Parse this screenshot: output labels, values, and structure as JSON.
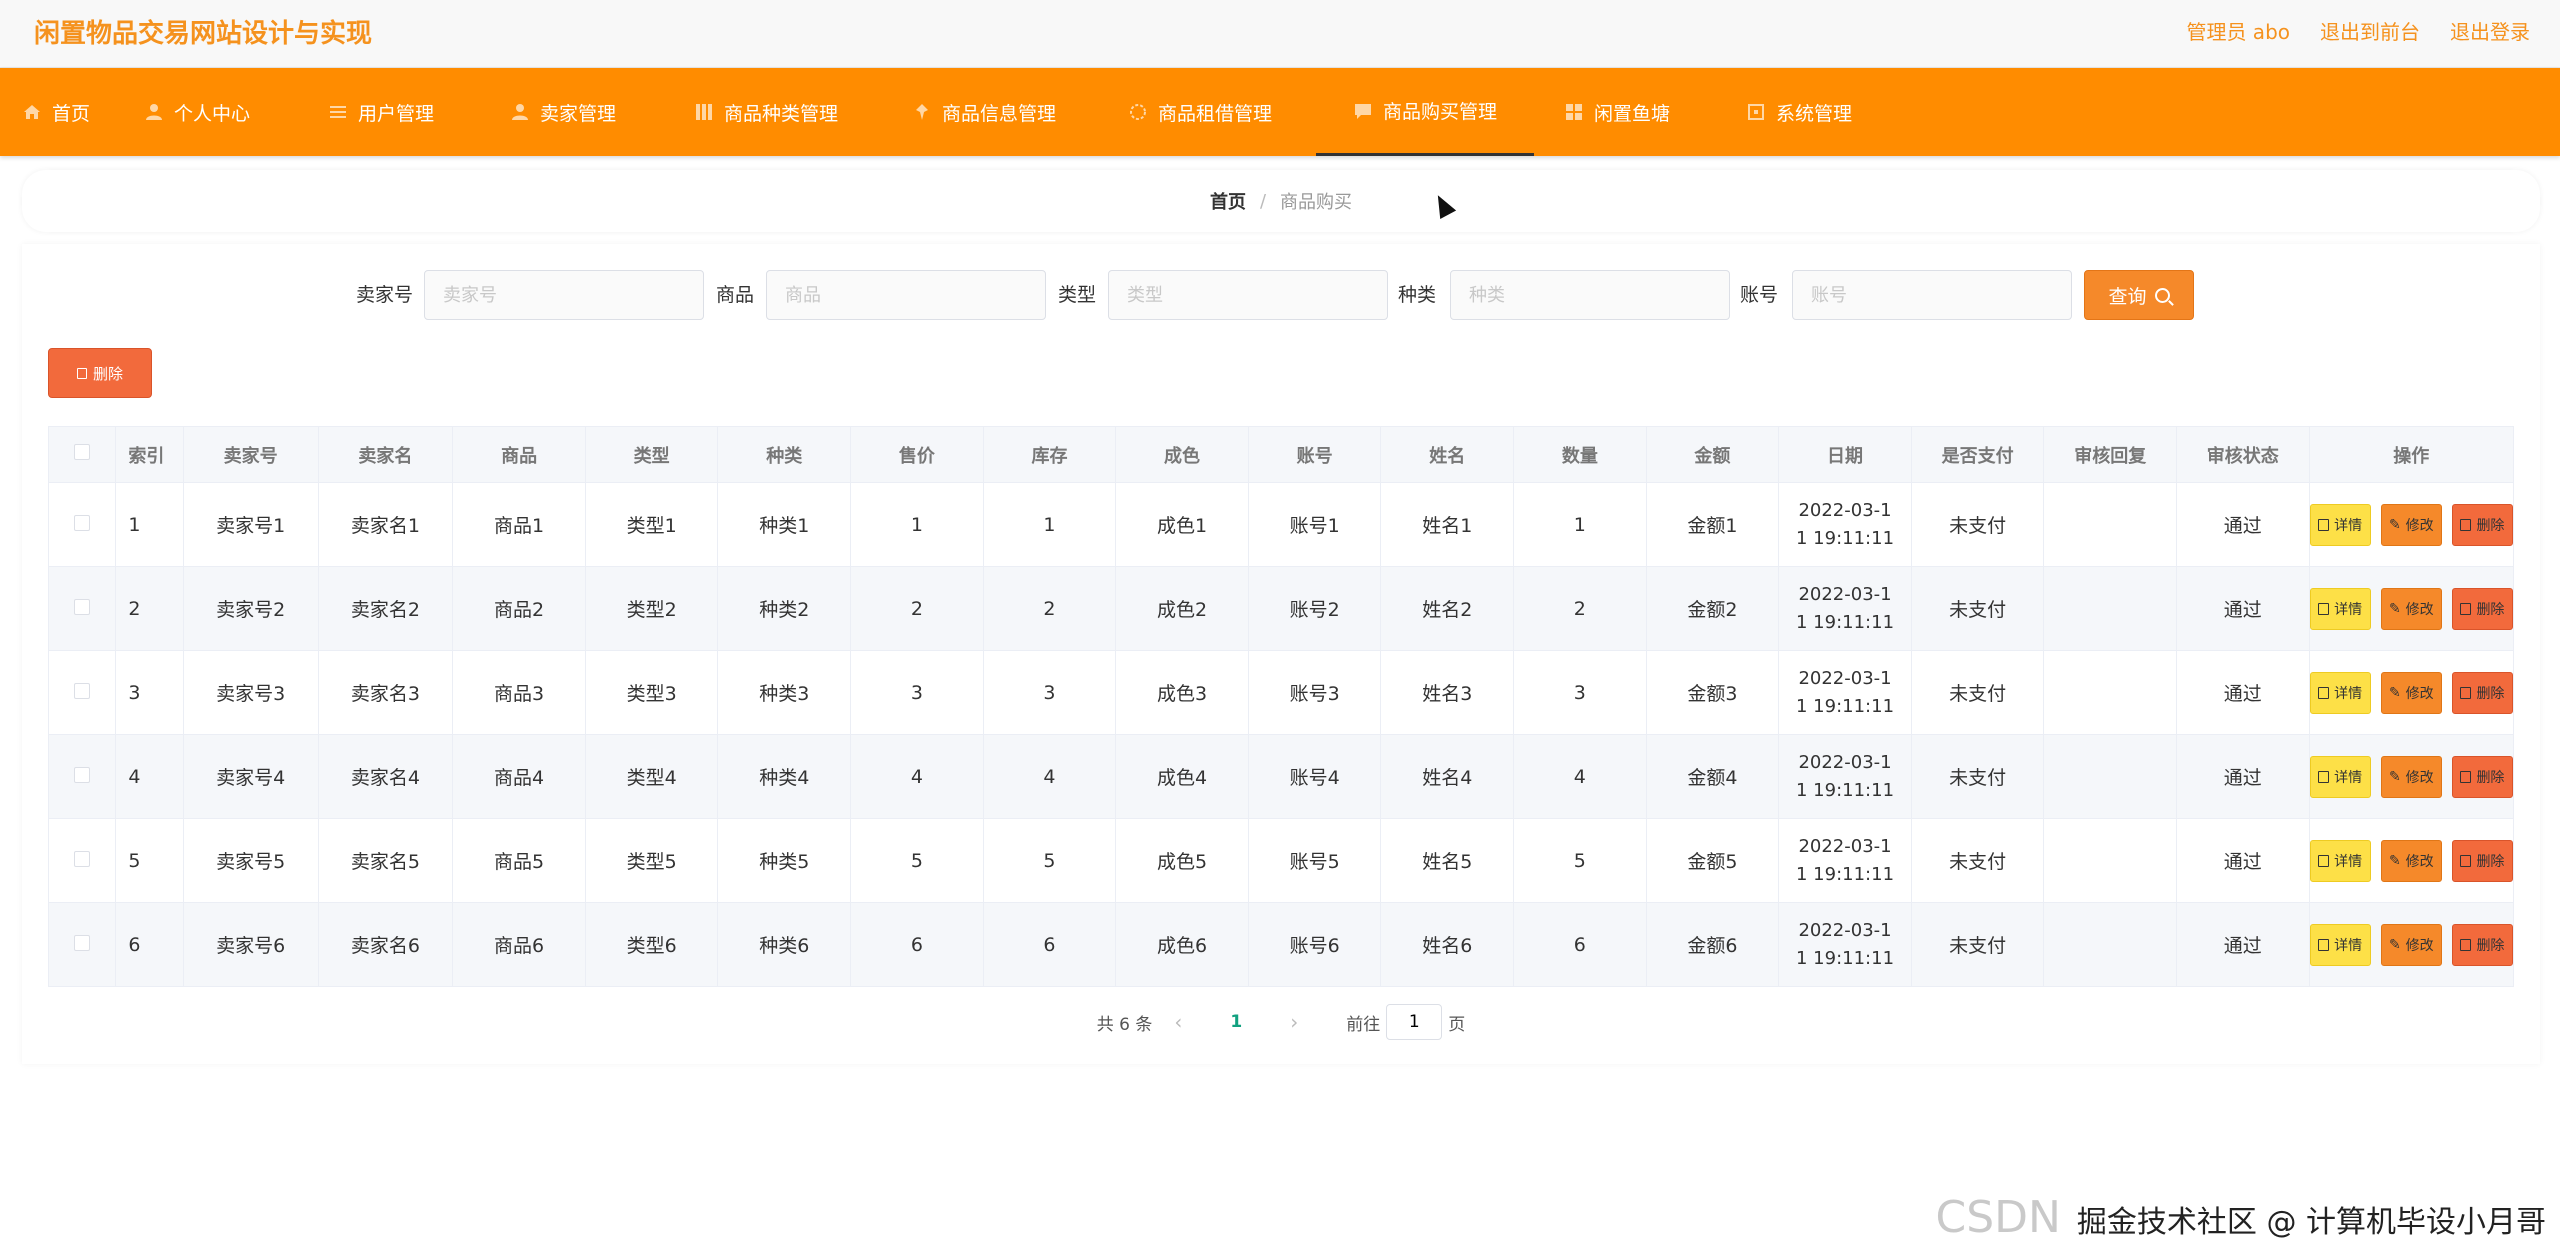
{
  "header": {
    "title": "闲置物品交易网站设计与实现",
    "admin_label": "管理员 abo",
    "back_to_front": "退出到前台",
    "logout": "退出登录"
  },
  "nav": {
    "items": [
      {
        "label": "首页",
        "icon": "home-icon"
      },
      {
        "label": "个人中心",
        "icon": "user-icon"
      },
      {
        "label": "用户管理",
        "icon": "list-icon"
      },
      {
        "label": "卖家管理",
        "icon": "user-icon"
      },
      {
        "label": "商品种类管理",
        "icon": "grid-icon"
      },
      {
        "label": "商品信息管理",
        "icon": "pin-icon"
      },
      {
        "label": "商品租借管理",
        "icon": "circle-icon"
      },
      {
        "label": "商品购买管理",
        "icon": "chat-icon"
      },
      {
        "label": "闲置鱼塘",
        "icon": "grid-icon"
      },
      {
        "label": "系统管理",
        "icon": "settings-icon"
      }
    ],
    "active_index": 7,
    "accent": "#ff8c00"
  },
  "breadcrumb": {
    "home": "首页",
    "separator": "/",
    "current": "商品购买"
  },
  "search": {
    "fields": [
      {
        "label": "卖家号",
        "placeholder": "卖家号"
      },
      {
        "label": "商品",
        "placeholder": "商品"
      },
      {
        "label": "类型",
        "placeholder": "类型"
      },
      {
        "label": "种类",
        "placeholder": "种类"
      },
      {
        "label": "账号",
        "placeholder": "账号"
      }
    ],
    "query_label": "查询"
  },
  "toolbar": {
    "delete_label": "删除"
  },
  "table": {
    "columns": [
      "索引",
      "卖家号",
      "卖家名",
      "商品",
      "类型",
      "种类",
      "售价",
      "库存",
      "成色",
      "账号",
      "姓名",
      "数量",
      "金额",
      "日期",
      "是否支付",
      "审核回复",
      "审核状态",
      "操作"
    ],
    "rows": [
      {
        "index": "1",
        "seller_no": "卖家号1",
        "seller_name": "卖家名1",
        "goods": "商品1",
        "type": "类型1",
        "kind": "种类1",
        "price": "1",
        "stock": "1",
        "condition": "成色1",
        "account": "账号1",
        "name": "姓名1",
        "qty": "1",
        "amount": "金额1",
        "date": "2022-03-11 19:11:11",
        "paid": "未支付",
        "reply": "",
        "status": "通过"
      },
      {
        "index": "2",
        "seller_no": "卖家号2",
        "seller_name": "卖家名2",
        "goods": "商品2",
        "type": "类型2",
        "kind": "种类2",
        "price": "2",
        "stock": "2",
        "condition": "成色2",
        "account": "账号2",
        "name": "姓名2",
        "qty": "2",
        "amount": "金额2",
        "date": "2022-03-11 19:11:11",
        "paid": "未支付",
        "reply": "",
        "status": "通过"
      },
      {
        "index": "3",
        "seller_no": "卖家号3",
        "seller_name": "卖家名3",
        "goods": "商品3",
        "type": "类型3",
        "kind": "种类3",
        "price": "3",
        "stock": "3",
        "condition": "成色3",
        "account": "账号3",
        "name": "姓名3",
        "qty": "3",
        "amount": "金额3",
        "date": "2022-03-11 19:11:11",
        "paid": "未支付",
        "reply": "",
        "status": "通过"
      },
      {
        "index": "4",
        "seller_no": "卖家号4",
        "seller_name": "卖家名4",
        "goods": "商品4",
        "type": "类型4",
        "kind": "种类4",
        "price": "4",
        "stock": "4",
        "condition": "成色4",
        "account": "账号4",
        "name": "姓名4",
        "qty": "4",
        "amount": "金额4",
        "date": "2022-03-11 19:11:11",
        "paid": "未支付",
        "reply": "",
        "status": "通过"
      },
      {
        "index": "5",
        "seller_no": "卖家号5",
        "seller_name": "卖家名5",
        "goods": "商品5",
        "type": "类型5",
        "kind": "种类5",
        "price": "5",
        "stock": "5",
        "condition": "成色5",
        "account": "账号5",
        "name": "姓名5",
        "qty": "5",
        "amount": "金额5",
        "date": "2022-03-11 19:11:11",
        "paid": "未支付",
        "reply": "",
        "status": "通过"
      },
      {
        "index": "6",
        "seller_no": "卖家号6",
        "seller_name": "卖家名6",
        "goods": "商品6",
        "type": "类型6",
        "kind": "种类6",
        "price": "6",
        "stock": "6",
        "condition": "成色6",
        "account": "账号6",
        "name": "姓名6",
        "qty": "6",
        "amount": "金额6",
        "date": "2022-03-11 19:11:11",
        "paid": "未支付",
        "reply": "",
        "status": "通过"
      }
    ],
    "actions": {
      "detail": "详情",
      "edit": "修改",
      "delete": "删除"
    }
  },
  "pagination": {
    "total": "共 6 条",
    "current_page": "1",
    "goto_prefix": "前往",
    "goto_value": "1",
    "goto_suffix": "页"
  },
  "watermark": {
    "left": "CSDN",
    "right": "掘金技术社区 @ 计算机毕设小月哥"
  },
  "colors": {
    "brand": "#f5921e",
    "detail_button": "#fde047",
    "edit_button": "#f5892a",
    "delete_button": "#f26a3c",
    "page_active": "#12a180"
  }
}
